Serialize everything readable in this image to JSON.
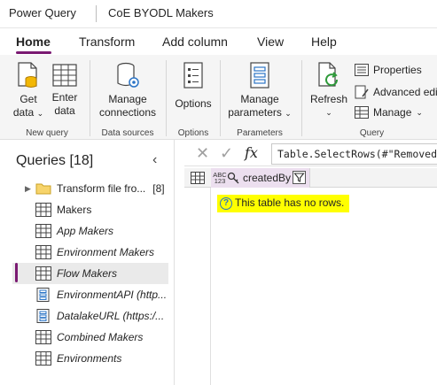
{
  "titlebar": {
    "app_name": "Power Query",
    "project_name": "CoE BYODL Makers"
  },
  "tabs": [
    {
      "label": "Home",
      "active": true
    },
    {
      "label": "Transform"
    },
    {
      "label": "Add column"
    },
    {
      "label": "View"
    },
    {
      "label": "Help"
    }
  ],
  "ribbon": {
    "new_query": {
      "get_data_line1": "Get",
      "get_data_line2": "data",
      "enter_data_line1": "Enter",
      "enter_data_line2": "data",
      "group_label": "New query"
    },
    "data_sources": {
      "manage_line1": "Manage",
      "manage_line2": "connections",
      "group_label": "Data sources"
    },
    "options": {
      "label": "Options",
      "group_label": "Options"
    },
    "parameters": {
      "manage_line1": "Manage",
      "manage_line2": "parameters",
      "group_label": "Parameters"
    },
    "query": {
      "refresh_label": "Refresh",
      "properties_label": "Properties",
      "advanced_editor_label": "Advanced editor",
      "manage_label": "Manage",
      "group_label": "Query"
    }
  },
  "queries": {
    "title": "Queries [18]",
    "items": [
      {
        "label": "Transform file fro...",
        "count": "[8]",
        "icon": "folder-icon",
        "italic": false
      },
      {
        "label": "Makers",
        "icon": "table-icon",
        "italic": false
      },
      {
        "label": "App Makers",
        "icon": "table-icon",
        "italic": true
      },
      {
        "label": "Environment Makers",
        "icon": "table-icon",
        "italic": true
      },
      {
        "label": "Flow Makers",
        "icon": "table-icon",
        "italic": true,
        "selected": true
      },
      {
        "label": "EnvironmentAPI (http...",
        "icon": "parameter-icon",
        "italic": true
      },
      {
        "label": "DatalakeURL (https:/...",
        "icon": "parameter-icon",
        "italic": true
      },
      {
        "label": "Combined Makers",
        "icon": "table-icon",
        "italic": true
      },
      {
        "label": "Environments",
        "icon": "table-icon",
        "italic": true
      }
    ]
  },
  "formula_bar": {
    "formula": "Table.SelectRows(#\"Removed c",
    "fx_label": "fx"
  },
  "grid": {
    "column_type": "ABC\n123",
    "column_name": "createdBy",
    "empty_message": "This table has no rows."
  },
  "colors": {
    "accent": "#7a1a72",
    "highlight": "#ffff00",
    "info": "#2b74c6"
  }
}
